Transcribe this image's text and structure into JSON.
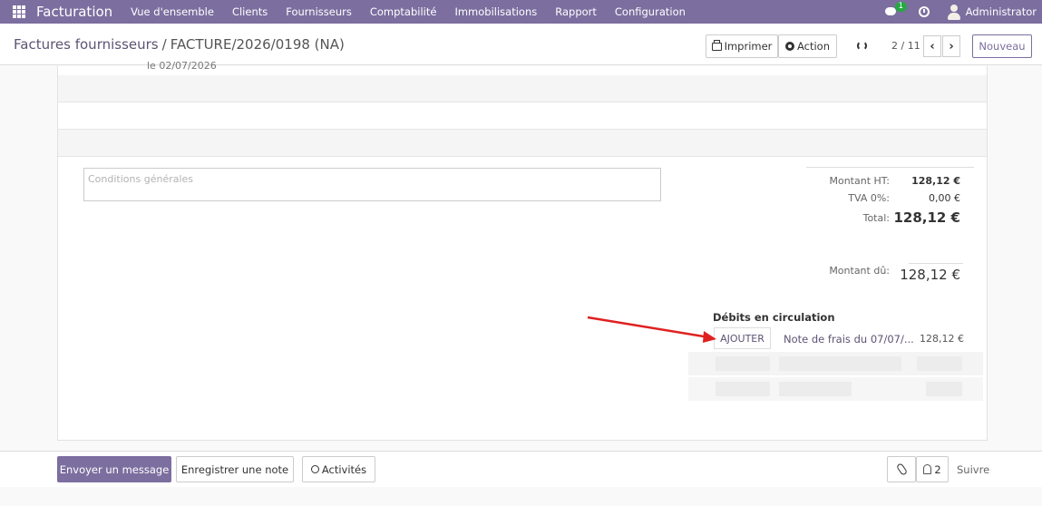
{
  "navbar": {
    "app_name": "Facturation",
    "menu": [
      "Vue d'ensemble",
      "Clients",
      "Fournisseurs",
      "Comptabilité",
      "Immobilisations",
      "Rapport",
      "Configuration"
    ],
    "chat_badge": "1",
    "user": "Administrator",
    "icons": [
      "apps-icon",
      "chat-icon",
      "clock-icon",
      "user-icon"
    ],
    "bg_color": "#7c6e9f"
  },
  "breadcrumb": {
    "parent": "Factures fournisseurs",
    "separator": "/",
    "current": "FACTURE/2026/0198 (NA)"
  },
  "toolbar": {
    "print_label": "Imprimer",
    "action_label": "Action",
    "pager": "2 / 11",
    "prev": "‹",
    "next": "›",
    "new_label": "Nouveau"
  },
  "form": {
    "cut_off_text": "le 02/07/2026",
    "terms_placeholder": "Conditions générales",
    "totals": {
      "ht_label": "Montant HT:",
      "ht_value": "128,12 €",
      "tva_label": "TVA 0%:",
      "tva_value": "0,00 €",
      "total_label": "Total:",
      "total_value": "128,12 €",
      "due_label": "Montant dû:",
      "due_value": "128,12 €"
    },
    "debits": {
      "title": "Débits en circulation",
      "add_label": "AJOUTER",
      "note": "Note de frais du 07/07/...",
      "amount": "128,12 €"
    }
  },
  "chatter": {
    "send_message": "Envoyer un message",
    "log_note": "Enregistrer une note",
    "activities": "Activités",
    "followers_count": "2",
    "follow": "Suivre"
  },
  "colors": {
    "brand": "#7c6e9f",
    "link": "#5e5373",
    "annotation_arrow": "#e02020"
  }
}
